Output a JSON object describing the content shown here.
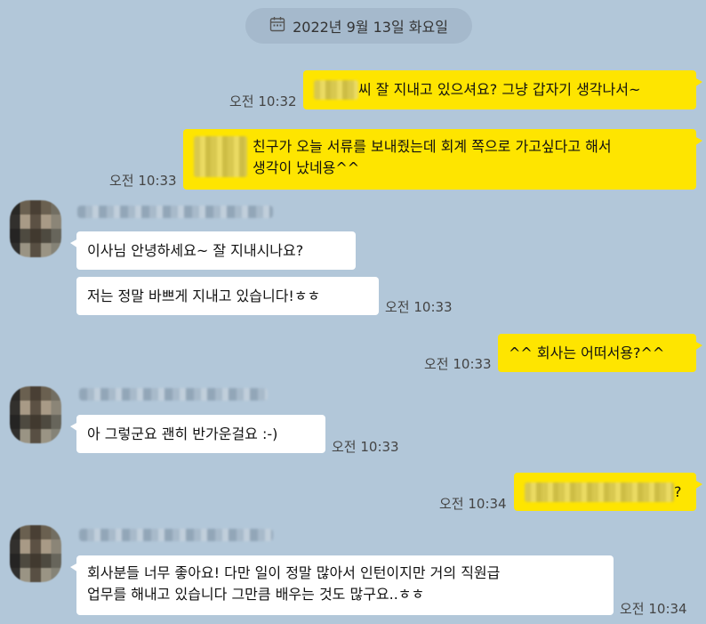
{
  "date_divider": {
    "icon": "calendar-icon",
    "label": "2022년 9월 13일 화요일"
  },
  "messages": [
    {
      "from": "me",
      "text": "씨 잘 지내고 있으셔요? 그냥 갑자기 생각나서~",
      "time": "오전 10:32"
    },
    {
      "from": "me",
      "text_lines": [
        "친구가 오늘 서류를 보내줬는데 회계 쪽으로 가고싶다고 해서",
        "생각이 났네용^^"
      ],
      "time": "오전 10:33"
    },
    {
      "from": "other",
      "text": "이사님 안녕하세요~ 잘 지내시나요?"
    },
    {
      "from": "other",
      "text": "저는 정말 바쁘게 지내고 있습니다!ㅎㅎ",
      "time": "오전 10:33"
    },
    {
      "from": "me",
      "text": "^^ 회사는 어떠서용?^^",
      "time": "오전 10:33"
    },
    {
      "from": "other",
      "text": "아 그렇군요 괜히 반가운걸요 :-)",
      "time": "오전 10:33"
    },
    {
      "from": "me",
      "text": "?",
      "time": "오전 10:34"
    },
    {
      "from": "other",
      "text_lines": [
        "회사분들 너무 좋아요! 다만 일이 정말 많아서 인턴이지만 거의 직원급",
        "업무를 해내고 있습니다 그만큼 배우는 것도 많구요..ㅎㅎ"
      ],
      "time": "오전 10:34"
    }
  ],
  "colors": {
    "background": "#b2c7d9",
    "my_bubble": "#fee500",
    "their_bubble": "#ffffff"
  }
}
